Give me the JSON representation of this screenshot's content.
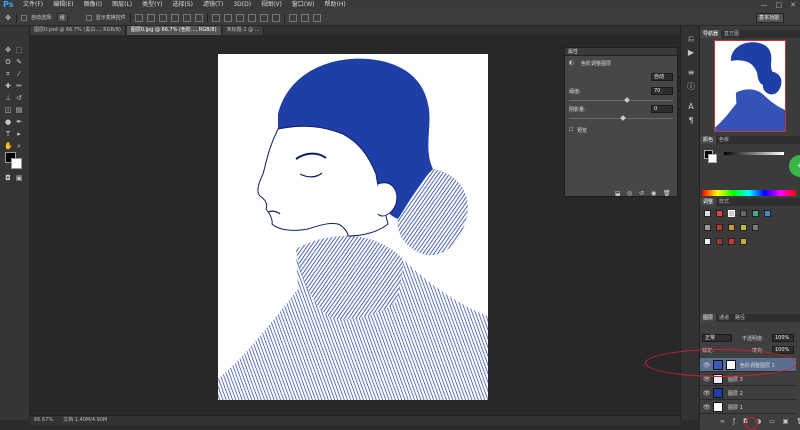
{
  "app": {
    "logo": "Ps"
  },
  "menu": [
    "文件(F)",
    "编辑(E)",
    "图像(I)",
    "图层(L)",
    "类型(Y)",
    "选择(S)",
    "滤镜(T)",
    "3D(D)",
    "视图(V)",
    "窗口(W)",
    "帮助(H)"
  ],
  "window_controls": [
    "—",
    "□",
    "✕"
  ],
  "options": {
    "auto_select_label": "自动选择:",
    "auto_select_value": "组",
    "transform_label": "显示变换控件",
    "workspace": "基本功能"
  },
  "tabs": [
    {
      "label": "图层0.psd @ 66.7% (黑白..., RGB/8)",
      "active": false
    },
    {
      "label": "图层0.jpg @ 66.7% (色阶..., RGB/8)",
      "active": true
    },
    {
      "label": "未标题-1 @ ...",
      "active": false
    }
  ],
  "status": {
    "zoom": "66.67%",
    "doc": "文档:1.40M/4.90M"
  },
  "properties": {
    "title": "属性",
    "adjustment_name": "色阶调整图层",
    "auto_button": "自动",
    "field1_label": "阈值:",
    "field1_value": "70",
    "field2_label": "阴影量:",
    "field2_value": "0",
    "checkbox_label": "预览"
  },
  "right_panels": {
    "navigator_tabs": [
      "导航器",
      "直方图"
    ],
    "color_tabs": [
      "颜色",
      "色板"
    ],
    "adjust_tabs": [
      "调整",
      "样式"
    ],
    "layers_tabs": [
      "图层",
      "通道",
      "路径"
    ],
    "blend_mode": "正常",
    "opacity_label": "不透明度:",
    "opacity_value": "100%",
    "fill_label": "填充:",
    "fill_value": "100%",
    "lock_label": "锁定:"
  },
  "layers": [
    {
      "name": "色阶调整图层 1",
      "selected": true,
      "thumb_color": "#3a5bb5",
      "has_mask": true
    },
    {
      "name": "图层 3",
      "selected": false,
      "thumb_color": "#e9ecf5",
      "has_mask": false
    },
    {
      "name": "图层 2",
      "selected": false,
      "thumb_color": "#1f3fa8",
      "has_mask": false
    },
    {
      "name": "图层 1",
      "selected": false,
      "thumb_color": "#ffffff",
      "has_mask": false
    }
  ],
  "colors": {
    "ink_blue": "#1e3ea8",
    "highlight_red": "#d02030",
    "accent_green": "#3bb54a"
  },
  "badge": "+"
}
